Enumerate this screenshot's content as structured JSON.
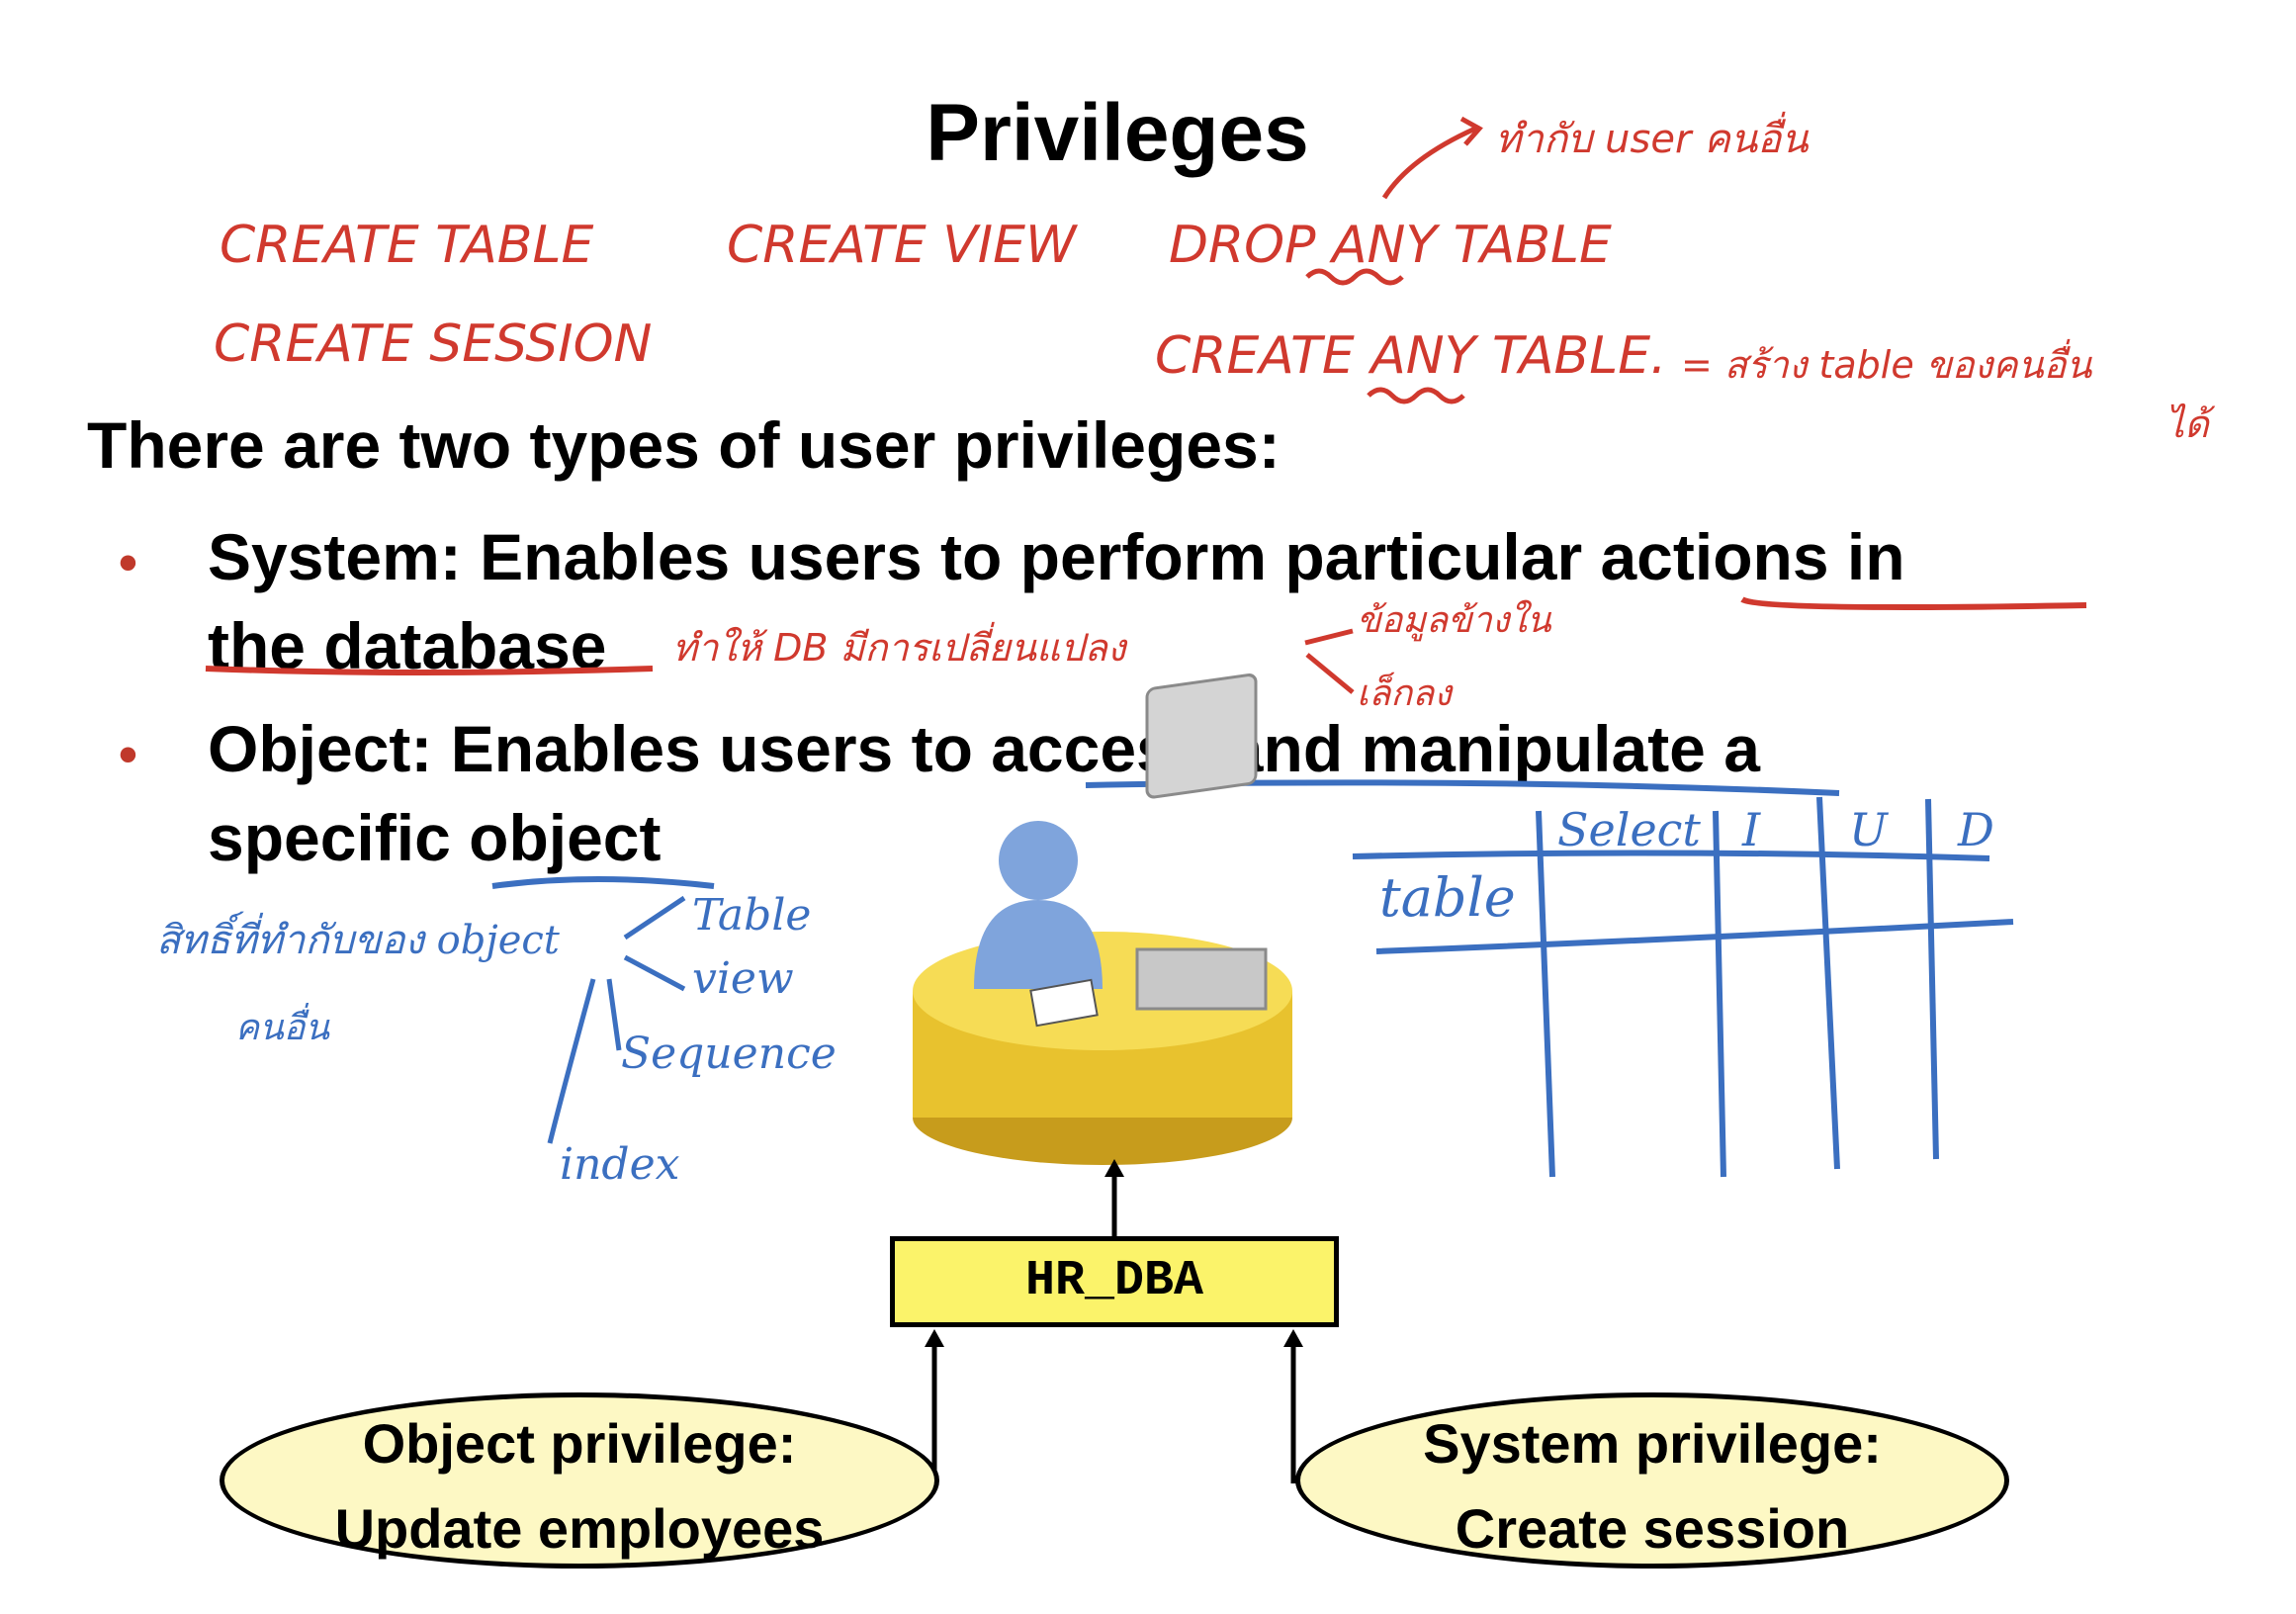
{
  "title": "Privileges",
  "intro": "There are two types of user privileges:",
  "bullets": [
    {
      "line1": "System: Enables users to perform particular actions in",
      "line2": "the database"
    },
    {
      "line1": "Object: Enables users to access and manipulate a",
      "line2": "specific object"
    }
  ],
  "handwritten": {
    "create_table": "CREATE TABLE",
    "create_view": "CREATE VIEW",
    "drop_any_table": "DROP ANY TABLE",
    "create_session": "CREATE SESSION",
    "create_any_table": "CREATE ANY TABLE.",
    "top_note": "ทำกับ user คนอื่น",
    "any_note_line1": "= สร้าง table ของคนอื่น",
    "any_note_line2": "ได้",
    "system_note": "ทำให้ DB มีการเปลี่ยนแปลง",
    "system_note_branch1": "ข้อมูลข้างใน",
    "system_note_branch2": "เล็กลง",
    "object_note": "สิทธิ์ที่ทำกับของ object",
    "object_note_sub": "คนอื่น",
    "object_types": [
      "Table",
      "view",
      "Sequence",
      "index"
    ],
    "grid_headers": [
      "Select",
      "I",
      "U",
      "D"
    ],
    "grid_row": "table"
  },
  "diagram": {
    "role": "HR_DBA",
    "object_privilege": {
      "line1": "Object privilege:",
      "line2": "Update employees"
    },
    "system_privilege": {
      "line1": "System privilege:",
      "line2": "Create session"
    }
  },
  "colors": {
    "bullet": "#c0392b",
    "ink_red": "#d0392e",
    "ink_blue": "#3b6fc0",
    "role_fill": "#fbf36a",
    "oval_fill": "#fdf8c4",
    "db_gold": "#e8c22e"
  }
}
